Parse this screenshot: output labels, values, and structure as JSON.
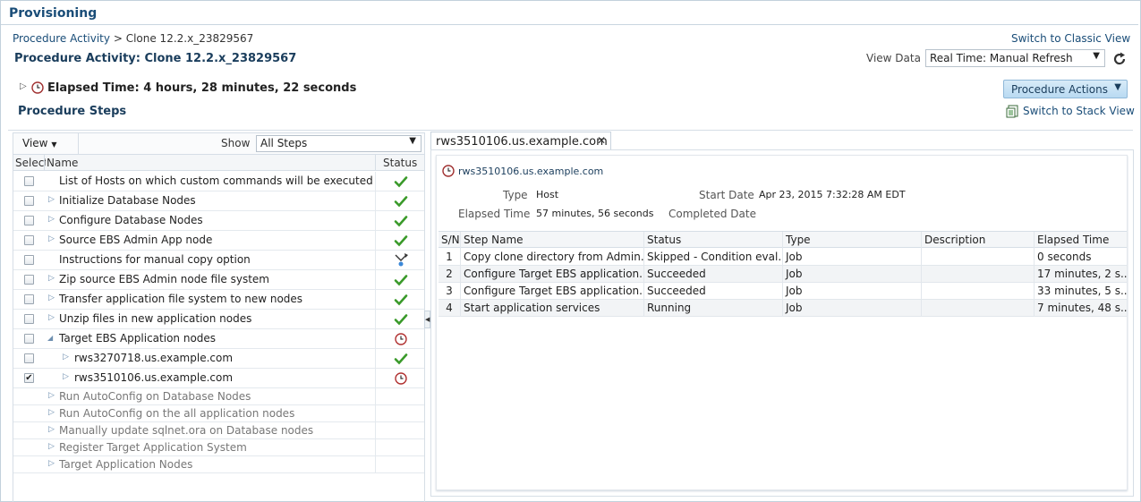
{
  "header": {
    "title": "Provisioning"
  },
  "breadcrumb": {
    "parent": "Procedure Activity",
    "separator": ">",
    "current": "Clone 12.2.x_23829567"
  },
  "page_title": "Procedure Activity: Clone 12.2.x_23829567",
  "links": {
    "switch_classic": "Switch to Classic View",
    "switch_stack": "Switch to Stack View"
  },
  "view_data": {
    "label": "View Data",
    "value": "Real Time: Manual Refresh"
  },
  "elapsed": {
    "label": "Elapsed Time:",
    "value": "4 hours, 28 minutes, 22 seconds"
  },
  "procedure_actions": "Procedure Actions",
  "procedure_steps_title": "Procedure Steps",
  "left": {
    "view_menu": "View",
    "show_label": "Show",
    "show_value": "All Steps",
    "columns": {
      "select": "Select",
      "name": "Name",
      "status": "Status"
    },
    "rows": [
      {
        "name": "List of Hosts on which custom commands will be executed",
        "status": "success-icon"
      },
      {
        "name": "Initialize Database Nodes",
        "status": "success-icon"
      },
      {
        "name": "Configure Database Nodes",
        "status": "success-icon"
      },
      {
        "name": "Source EBS Admin App node",
        "status": "success-icon"
      },
      {
        "name": "Instructions for manual copy option",
        "status": "skipped-icon"
      },
      {
        "name": "Zip source EBS Admin node file system",
        "status": "success-icon"
      },
      {
        "name": "Transfer application file system to new nodes",
        "status": "success-icon"
      },
      {
        "name": "Unzip files in new application nodes",
        "status": "success-icon"
      },
      {
        "name": "Target EBS Application nodes",
        "status": "running-icon"
      },
      {
        "name": "rws3270718.us.example.com",
        "status": "success-icon"
      },
      {
        "name": "rws3510106.us.example.com",
        "status": "running-icon",
        "checked": true
      },
      {
        "name": "Run AutoConfig on Database Nodes"
      },
      {
        "name": "Run AutoConfig on the all application nodes"
      },
      {
        "name": "Manually update sqlnet.ora on Database nodes"
      },
      {
        "name": "Register Target Application System"
      },
      {
        "name": "Target Application Nodes"
      }
    ]
  },
  "right": {
    "tab_label": "rws3510106.us.example.com",
    "host": "rws3510106.us.example.com",
    "type_label": "Type",
    "type_value": "Host",
    "start_label": "Start Date",
    "start_value": "Apr 23, 2015 7:32:28 AM EDT",
    "elapsed_label": "Elapsed Time",
    "elapsed_value": "57 minutes, 56 seconds",
    "completed_label": "Completed Date",
    "columns": [
      "S/N",
      "Step Name",
      "Status",
      "Type",
      "Description",
      "Elapsed Time"
    ],
    "rows": [
      {
        "sn": "1",
        "step": "Copy clone directory from Admin...",
        "status": "Skipped - Condition eval...",
        "type": "Job",
        "desc": "",
        "elapsed": "0 seconds"
      },
      {
        "sn": "2",
        "step": "Configure Target EBS application...",
        "status": "Succeeded",
        "type": "Job",
        "desc": "",
        "elapsed": "17 minutes, 2 s..."
      },
      {
        "sn": "3",
        "step": "Configure Target EBS application...",
        "status": "Succeeded",
        "type": "Job",
        "desc": "",
        "elapsed": "33 minutes, 5 s..."
      },
      {
        "sn": "4",
        "step": "Start application services",
        "status": "Running",
        "type": "Job",
        "desc": "",
        "elapsed": "7 minutes, 48 s..."
      }
    ]
  },
  "colors": {
    "accent": "#1a4d78",
    "success": "#3a9a2a",
    "running": "#b03030",
    "button_bg": "#c6e1f5"
  }
}
